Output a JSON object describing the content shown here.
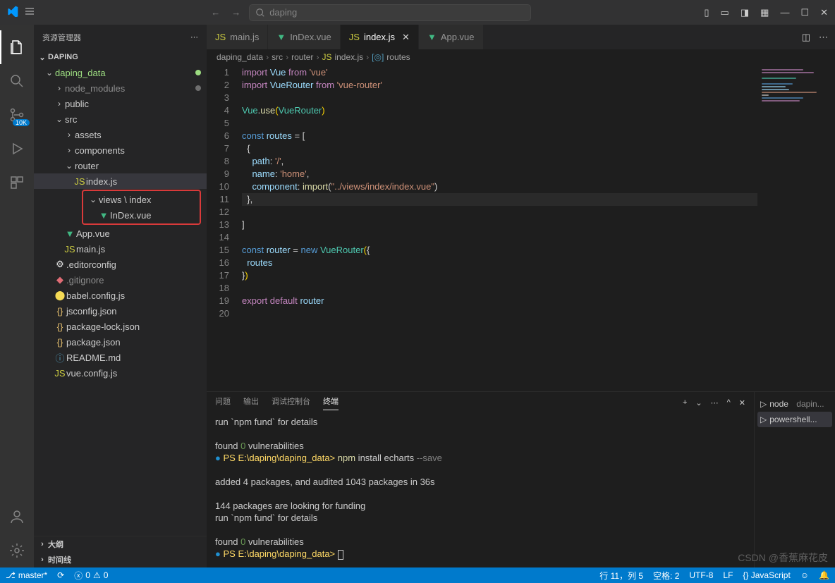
{
  "titlebar": {
    "search_placeholder": "daping"
  },
  "activitybar": {
    "badge_10k": "10K"
  },
  "sidebar": {
    "title": "资源管理器",
    "project": "DAPING",
    "tree": {
      "daping_data": "daping_data",
      "node_modules": "node_modules",
      "public": "public",
      "src": "src",
      "assets": "assets",
      "components": "components",
      "router": "router",
      "router_index": "index.js",
      "views_index": "views \\ index",
      "index_vue": "InDex.vue",
      "app_vue": "App.vue",
      "main_js": "main.js",
      "editorconfig": ".editorconfig",
      "gitignore": ".gitignore",
      "babel": "babel.config.js",
      "jsconfig": "jsconfig.json",
      "pkglock": "package-lock.json",
      "pkg": "package.json",
      "readme": "README.md",
      "vueconfig": "vue.config.js"
    },
    "outline": "大纲",
    "timeline": "时间线"
  },
  "tabs": {
    "main_js": "main.js",
    "index_vue": "InDex.vue",
    "index_js": "index.js",
    "app_vue": "App.vue"
  },
  "breadcrumb": {
    "p1": "daping_data",
    "p2": "src",
    "p3": "router",
    "p4": "index.js",
    "p5": "routes"
  },
  "code": {
    "lines": 20,
    "l1_import": "import",
    "l1_vue": "Vue",
    "l1_from": "from",
    "l1_str": "'vue'",
    "l2_import": "import",
    "l2_vr": "VueRouter",
    "l2_from": "from",
    "l2_str": "'vue-router'",
    "l4_vue": "Vue",
    "l4_use": "use",
    "l4_vr": "VueRouter",
    "l6_const": "const",
    "l6_routes": "routes",
    "l6_eq": " = [",
    "l8_path": "path",
    "l8_pathv": "'/'",
    "l9_name": "name",
    "l9_namev": "'home'",
    "l10_comp": "component",
    "l10_import": "import",
    "l10_str": "\"../views/index/index.vue\"",
    "l15_const": "const",
    "l15_router": "router",
    "l15_new": "new",
    "l15_vr": "VueRouter",
    "l16_routes": "routes",
    "l19_export": "export",
    "l19_default": "default",
    "l19_router": "router"
  },
  "panel": {
    "tab_problems": "问题",
    "tab_output": "输出",
    "tab_debug": "调试控制台",
    "tab_terminal": "终端",
    "side_node": "node",
    "side_node_extra": "dapin...",
    "side_ps": "powershell...",
    "t1": "  run `npm fund` for details",
    "t2": "found ",
    "t2b": "0",
    "t2c": " vulnerabilities",
    "t3a": "PS E:\\daping\\daping_data> ",
    "t3b": "npm",
    "t3c": " install echarts ",
    "t3d": "--save",
    "t4": "added 4 packages, and audited 1043 packages in 36s",
    "t5": "144 packages are looking for funding",
    "t6": "  run `npm fund` for details",
    "t7": "found ",
    "t7b": "0",
    "t7c": " vulnerabilities",
    "t8": "PS E:\\daping\\daping_data> "
  },
  "status": {
    "branch": "master*",
    "sync": "",
    "errors": "0",
    "warnings": "0",
    "line_col": "行 11，列 5",
    "spaces": "空格: 2",
    "encoding": "UTF-8",
    "eol": "LF",
    "lang": "{} JavaScript"
  },
  "watermark": "CSDN @香蕉麻花皮"
}
